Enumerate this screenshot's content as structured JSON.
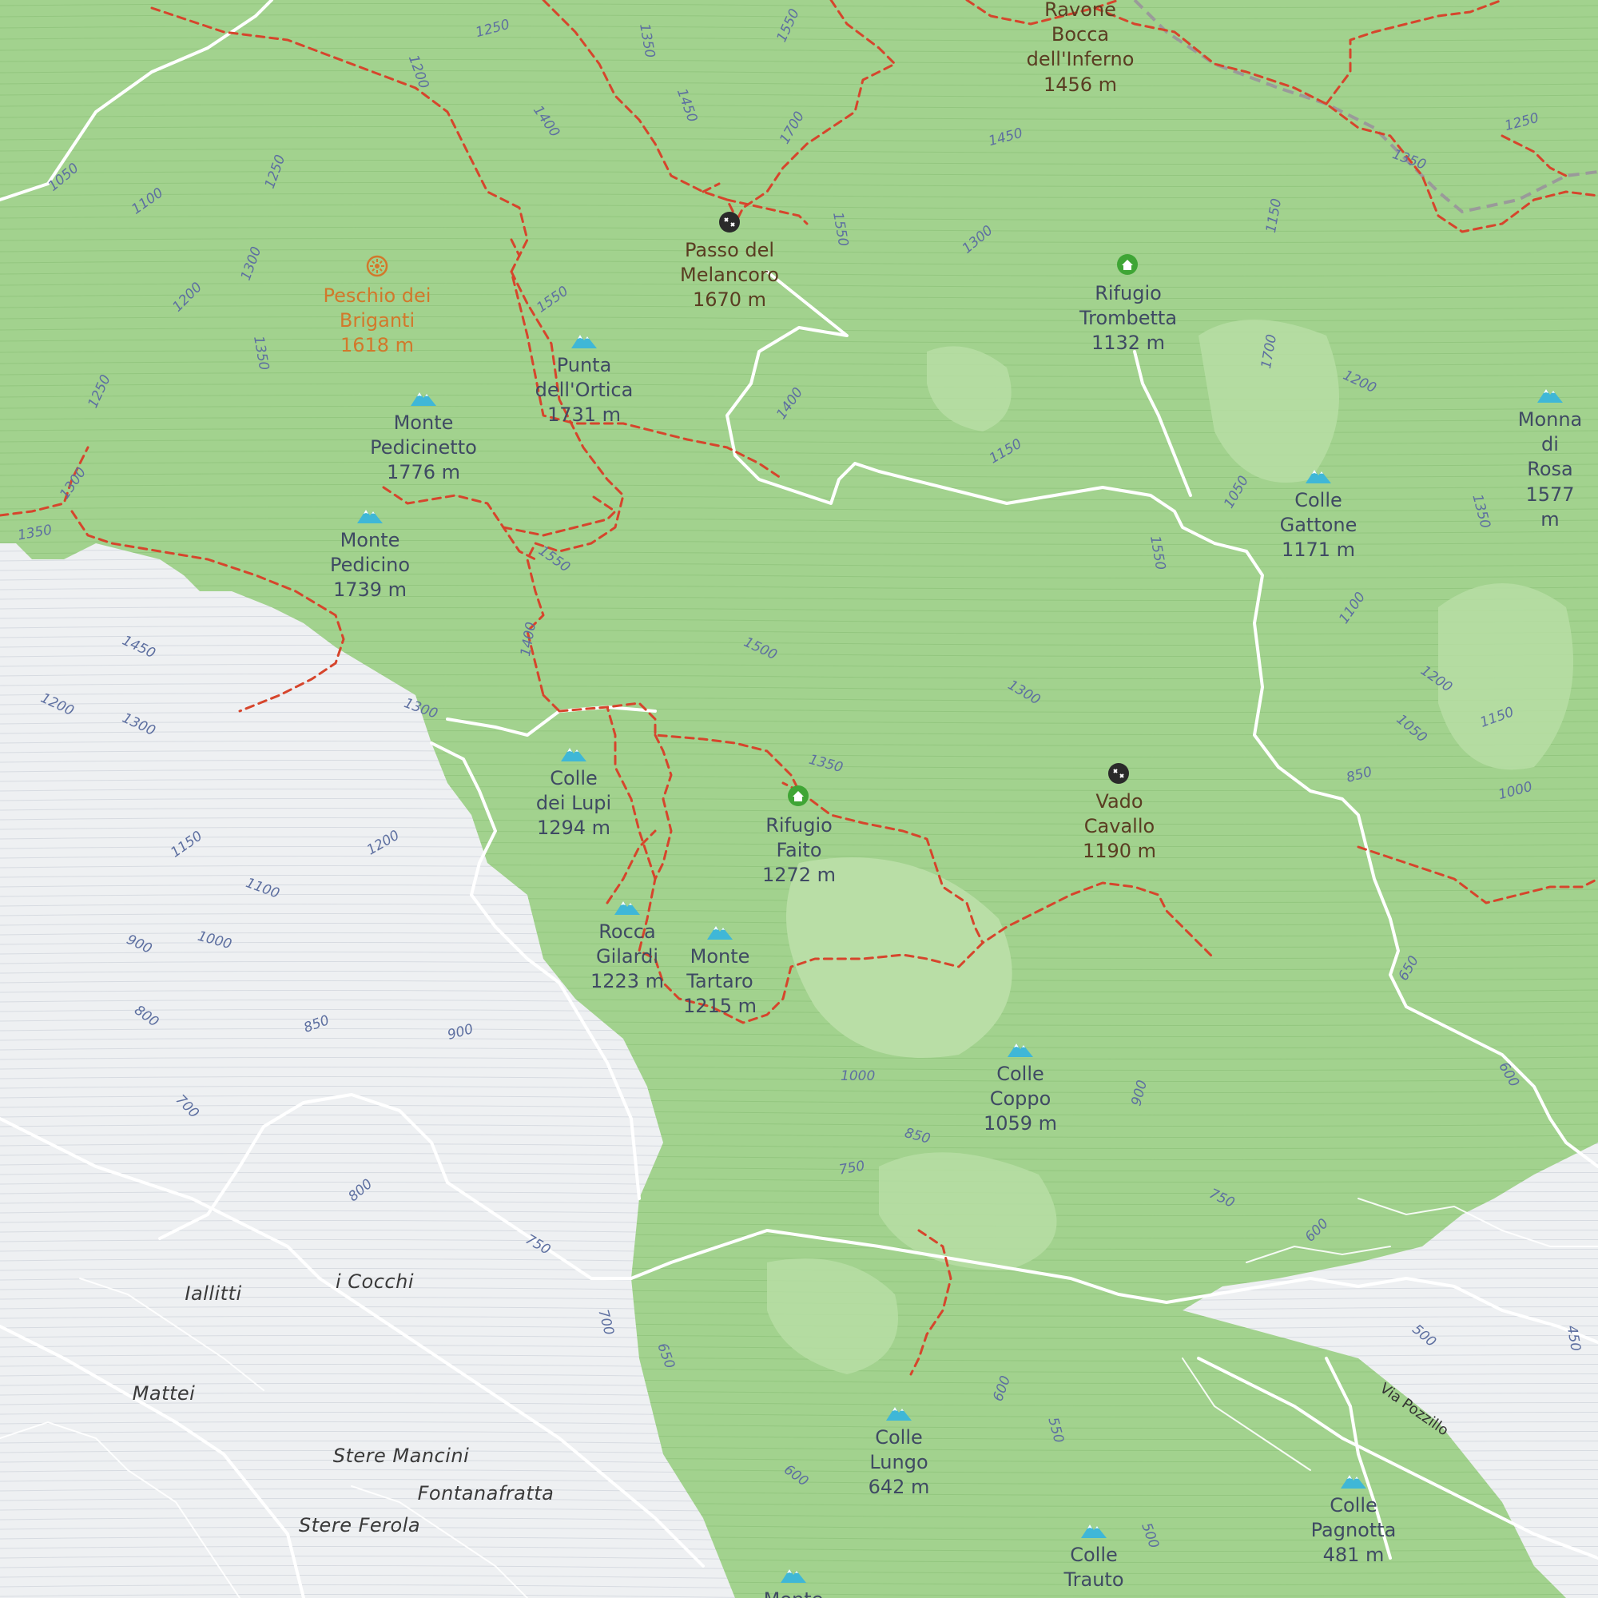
{
  "colors": {
    "forest": "#9fd08b",
    "forest_light": "#b9dea6",
    "lowland": "#eef0f2",
    "trail": "#d6452c",
    "road": "#ffffff",
    "peak_icon": "#3fb7d7",
    "hut_icon": "#3fa535",
    "pass_icon": "#2a2a2a",
    "poi_icon": "#d2782b"
  },
  "peaks": [
    {
      "id": "monte-pedicinetto",
      "name": "Monte\nPedicinetto\n1776 m"
    },
    {
      "id": "monte-pedicino",
      "name": "Monte\nPedicino\n1739 m"
    },
    {
      "id": "punta-dell-ortica",
      "name": "Punta\ndell'Ortica\n1731 m"
    },
    {
      "id": "monna-di-rosa",
      "name": "Monna\ndi Rosa\n1577 m"
    },
    {
      "id": "colle-gattone",
      "name": "Colle\nGattone\n1171 m"
    },
    {
      "id": "colle-dei-lupi",
      "name": "Colle\ndei Lupi\n1294 m"
    },
    {
      "id": "rocca-gilardi",
      "name": "Rocca\nGilardi\n1223 m"
    },
    {
      "id": "monte-tartaro",
      "name": "Monte\nTartaro\n1215 m"
    },
    {
      "id": "colle-coppo",
      "name": "Colle\nCoppo\n1059 m"
    },
    {
      "id": "colle-lungo",
      "name": "Colle\nLungo\n642 m"
    },
    {
      "id": "colle-pagnotta",
      "name": "Colle\nPagnotta\n481 m"
    },
    {
      "id": "colle-trauto",
      "name": "Colle\nTrauto"
    },
    {
      "id": "monte-bottom",
      "name": "Monte"
    }
  ],
  "passes": [
    {
      "id": "passo-del-melancoro",
      "name": "Passo del\nMelancoro\n1670 m"
    },
    {
      "id": "vado-cavallo",
      "name": "Vado\nCavallo\n1190 m"
    },
    {
      "id": "ravone",
      "name": "Ravone\nBocca\ndell'Inferno\n1456 m"
    }
  ],
  "huts": [
    {
      "id": "rifugio-trombetta",
      "name": "Rifugio\nTrombetta\n1132 m"
    },
    {
      "id": "rifugio-faito",
      "name": "Rifugio\nFaito\n1272 m"
    }
  ],
  "poi": [
    {
      "id": "peschio-dei-briganti",
      "name": "Peschio dei\nBriganti\n1618 m"
    }
  ],
  "localities": [
    "Iallitti",
    "i Cocchi",
    "Mattei",
    "Stere Mancini",
    "Fontanafratta",
    "Stere Ferola"
  ],
  "streets": [
    "Via Pozzillo"
  ],
  "contour_labels": [
    "1250",
    "1200",
    "1050",
    "1100",
    "1250",
    "1300",
    "1200",
    "1350",
    "1250",
    "1300",
    "1350",
    "1400",
    "1350",
    "1450",
    "1550",
    "1550",
    "1550",
    "1700",
    "1450",
    "1300",
    "1550",
    "1400",
    "1150",
    "1150",
    "1700",
    "1200",
    "1050",
    "1350",
    "1500",
    "1300",
    "1550",
    "1400",
    "1450",
    "1200",
    "1300",
    "1300",
    "1350",
    "1150",
    "1200",
    "1100",
    "1000",
    "900",
    "800",
    "850",
    "900",
    "700",
    "800",
    "750",
    "700",
    "650",
    "600",
    "1000",
    "850",
    "750",
    "900",
    "750",
    "600",
    "500",
    "450",
    "600",
    "550",
    "500",
    "1100",
    "1200",
    "1050",
    "1150",
    "1000",
    "850",
    "650",
    "600",
    "1250",
    "1350"
  ]
}
